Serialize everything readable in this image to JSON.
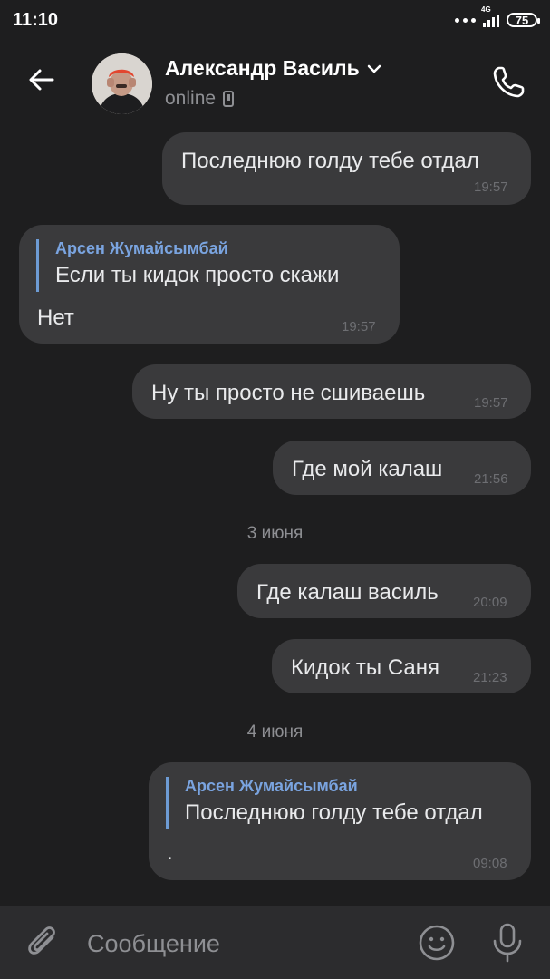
{
  "status_bar": {
    "time": "11:10",
    "network": "4G",
    "battery": "75"
  },
  "header": {
    "back_icon": "arrow-left-icon",
    "contact_name": "Александр Василь",
    "status": "online",
    "status_device_icon": "mobile-device-icon",
    "call_icon": "phone-icon"
  },
  "messages": [
    {
      "direction": "outgoing",
      "text": "Последнюю голду тебе отдал",
      "time": "19:57"
    },
    {
      "direction": "incoming",
      "reply_author": "Арсен Жумайсымбай",
      "reply_text": "Если ты кидок просто скажи",
      "text": "Нет",
      "time": "19:57"
    },
    {
      "direction": "outgoing",
      "text": "Ну ты просто не сшиваешь",
      "time": "19:57"
    },
    {
      "direction": "outgoing",
      "text": "Где мой калаш",
      "time": "21:56"
    },
    {
      "date_separator": "3 июня"
    },
    {
      "direction": "outgoing",
      "text": "Где калаш василь",
      "time": "20:09"
    },
    {
      "direction": "outgoing",
      "text": "Кидок ты Саня",
      "time": "21:23"
    },
    {
      "date_separator": "4 июня"
    },
    {
      "direction": "outgoing",
      "reply_author": "Арсен Жумайсымбай",
      "reply_text": "Последнюю голду тебе отдал",
      "text": ".",
      "time": "09:08"
    }
  ],
  "composer": {
    "placeholder": "Сообщение",
    "attach_icon": "paperclip-icon",
    "emoji_icon": "smile-icon",
    "mic_icon": "microphone-icon"
  },
  "colors": {
    "background": "#1e1e1f",
    "bubble": "#3a3a3c",
    "reply_accent": "#7aa4e0",
    "composer_bg": "#2c2c2e"
  }
}
